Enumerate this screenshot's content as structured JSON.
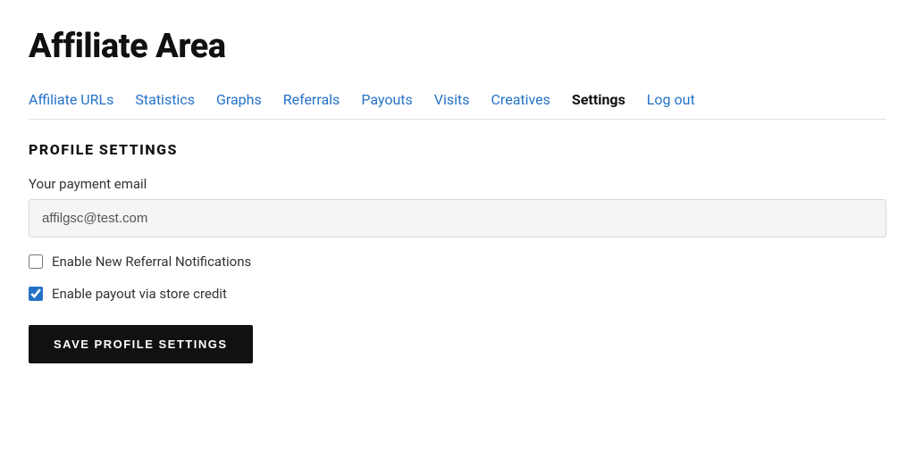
{
  "page": {
    "title": "Affiliate Area"
  },
  "nav": {
    "items": [
      {
        "label": "Affiliate URLs",
        "active": false
      },
      {
        "label": "Statistics",
        "active": false
      },
      {
        "label": "Graphs",
        "active": false
      },
      {
        "label": "Referrals",
        "active": false
      },
      {
        "label": "Payouts",
        "active": false
      },
      {
        "label": "Visits",
        "active": false
      },
      {
        "label": "Creatives",
        "active": false
      },
      {
        "label": "Settings",
        "active": true
      },
      {
        "label": "Log out",
        "active": false
      }
    ]
  },
  "profile_settings": {
    "section_title": "PROFILE SETTINGS",
    "payment_email_label": "Your payment email",
    "payment_email_value": "affilgsc@test.com",
    "payment_email_placeholder": "affilgsc@test.com",
    "checkbox_referral_label": "Enable New Referral Notifications",
    "checkbox_referral_checked": false,
    "checkbox_payout_label": "Enable payout via store credit",
    "checkbox_payout_checked": true,
    "save_button_label": "SAVE PROFILE SETTINGS"
  }
}
